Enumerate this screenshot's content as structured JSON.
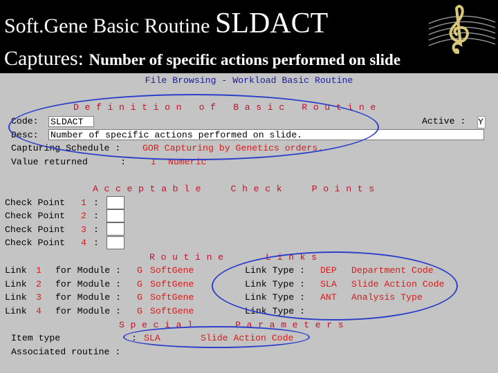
{
  "slide": {
    "title_prefix": "Soft.Gene Basic Routine ",
    "title_code": "SLDACT",
    "captures_label": "Captures:",
    "captures_text": "Number of specific actions performed on slide"
  },
  "screen": {
    "header": "File Browsing - Workload Basic Routine",
    "definition_heading": "Definition of Basic Routine",
    "code_label": "Code:",
    "code_value": "SLDACT",
    "active_label": "Active :",
    "active_value": "Y",
    "desc_label": "Desc:",
    "desc_value": "Number of specific actions performed on slide.",
    "capturing_label": "Capturing Schedule :",
    "capturing_value": "GOR Capturing by Genetics orders.",
    "value_label": "Value returned      :",
    "value_code": "I",
    "value_text": "Numeric",
    "checkpoints_heading": "Acceptable Check Points",
    "check_points": [
      {
        "label": "Check Point",
        "num": "1",
        "sep": ":"
      },
      {
        "label": "Check Point",
        "num": "2",
        "sep": ":"
      },
      {
        "label": "Check Point",
        "num": "3",
        "sep": ":"
      },
      {
        "label": "Check Point",
        "num": "4",
        "sep": ":"
      }
    ],
    "links_heading": "Routine Links",
    "links": [
      {
        "label": "Link",
        "num": "1",
        "for": "for Module :",
        "module_code": "G",
        "module": "SoftGene",
        "type_label": "Link Type :",
        "type_code": "DEP",
        "type_name": "Department Code"
      },
      {
        "label": "Link",
        "num": "2",
        "for": "for Module :",
        "module_code": "G",
        "module": "SoftGene",
        "type_label": "Link Type :",
        "type_code": "SLA",
        "type_name": "Slide Action Code"
      },
      {
        "label": "Link",
        "num": "3",
        "for": "for Module :",
        "module_code": "G",
        "module": "SoftGene",
        "type_label": "Link Type :",
        "type_code": "ANT",
        "type_name": "Analysis Type"
      },
      {
        "label": "Link",
        "num": "4",
        "for": "for Module :",
        "module_code": "G",
        "module": "SoftGene",
        "type_label": "Link Type :",
        "type_code": "",
        "type_name": ""
      }
    ],
    "params_heading": "Special Parameters",
    "item_type_label": "Item type",
    "item_type_sep": ":",
    "item_type_code": "SLA",
    "item_type_name": "Slide Action Code",
    "assoc_label": "Associated routine :"
  },
  "colors": {
    "screen_bg": "#c4c4c4",
    "value_red": "#d81c1c",
    "heading_red": "#c0102a",
    "annotation_blue": "#2c3fc8"
  },
  "icons": {
    "logo": "treble-clef-logo-icon"
  }
}
